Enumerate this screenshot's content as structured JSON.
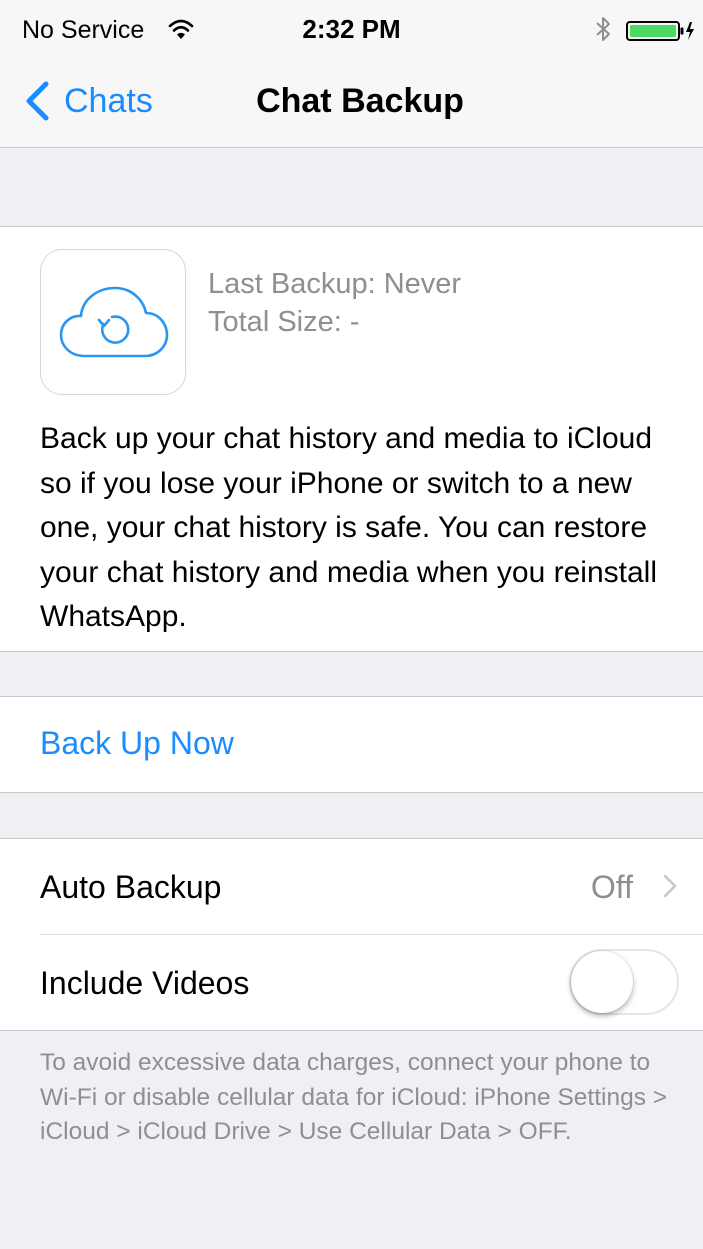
{
  "status_bar": {
    "carrier": "No Service",
    "time": "2:32 PM",
    "icons": [
      "wifi-icon",
      "bluetooth-icon",
      "battery-icon"
    ]
  },
  "nav": {
    "back_label": "Chats",
    "title": "Chat Backup",
    "back_icon": "chevron-left-icon"
  },
  "backup_info": {
    "icon": "icloud-backup-icon",
    "last_backup": "Last Backup: Never",
    "total_size": "Total Size: -",
    "description": "Back up your chat history and media to iCloud so if you lose your iPhone or switch to a new one, your chat history is safe. You can restore your chat history and media when you reinstall WhatsApp."
  },
  "actions": {
    "back_up_now": "Back Up Now"
  },
  "settings": {
    "auto_backup": {
      "label": "Auto Backup",
      "value": "Off"
    },
    "include_videos": {
      "label": "Include Videos",
      "enabled": false
    }
  },
  "footer_note": "To avoid excessive data charges, connect your phone to Wi-Fi or disable cellular data for iCloud: iPhone Settings > iCloud > iCloud Drive > Use Cellular Data > OFF.",
  "colors": {
    "accent": "#1a8cff",
    "background": "#efeff4",
    "secondary_text": "#8e8e93",
    "battery": "#4cd964"
  }
}
